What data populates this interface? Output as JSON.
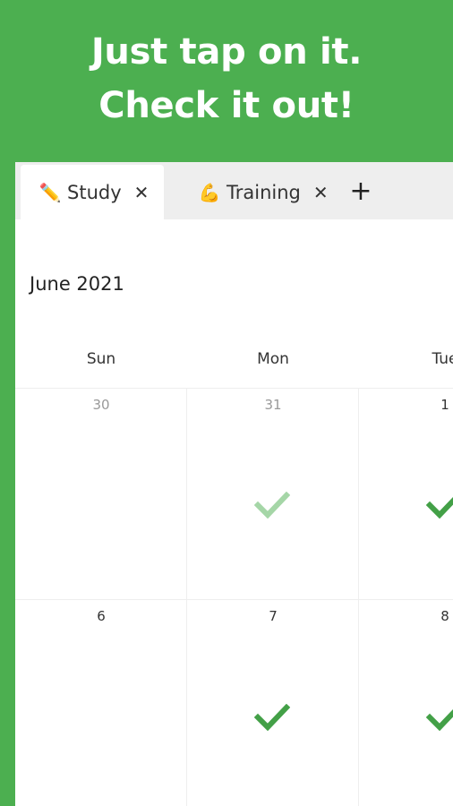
{
  "headline": {
    "line1": "Just tap on it.",
    "line2": "Check it out!"
  },
  "tabs": [
    {
      "emoji": "✏️",
      "label": "Study",
      "close": "✕"
    },
    {
      "emoji": "💪",
      "label": "Training",
      "close": "✕"
    }
  ],
  "add_tab": "+",
  "calendar": {
    "month_label": "June 2021",
    "weekdays": [
      "Sun",
      "Mon",
      "Tue"
    ],
    "dates_row1": [
      "30",
      "31",
      "1"
    ],
    "dates_row2": [
      "6",
      "7",
      "8"
    ]
  },
  "colors": {
    "brand_green": "#4caf50",
    "check_green": "#43a047",
    "check_faded": "#a5d6a7"
  },
  "icons": {
    "check": "check-icon"
  }
}
